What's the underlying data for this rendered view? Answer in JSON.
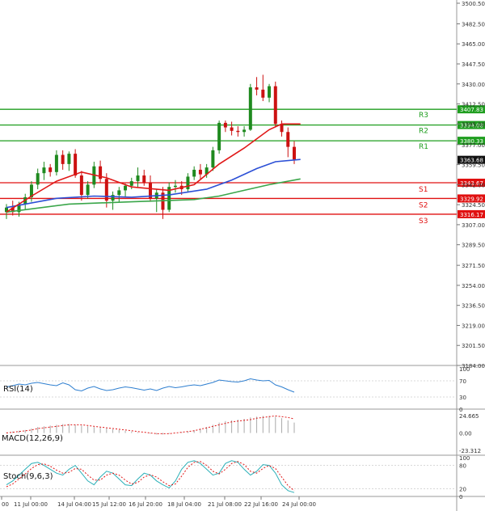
{
  "chart_data": {
    "type": "candlestick",
    "price_axis": {
      "min": 3184.0,
      "max": 3500.5,
      "ticks": [
        3500.5,
        3482.5,
        3465.0,
        3447.5,
        3430.0,
        3412.5,
        3395.0,
        3377.0,
        3359.5,
        3342.0,
        3324.5,
        3307.0,
        3289.5,
        3271.5,
        3254.0,
        3236.5,
        3219.0,
        3201.5,
        3184.0
      ]
    },
    "x_labels": [
      "00",
      "11 Jul 00:00",
      "14 Jul 04:00",
      "15 Jul 12:00",
      "16 Jul 20:00",
      "18 Jul 04:00",
      "21 Jul 08:00",
      "22 Jul 16:00",
      "24 Jul 00:00"
    ],
    "levels": [
      {
        "label": "R3",
        "value": 3407.83,
        "value_text": "3407.83",
        "color": "#1f9e1f"
      },
      {
        "label": "R2",
        "value": 3394.08,
        "value_text": "3394.08",
        "color": "#1f9e1f"
      },
      {
        "label": "R1",
        "value": 3380.33,
        "value_text": "3380.33",
        "color": "#1f9e1f"
      },
      {
        "label": "S1",
        "value": 3343.67,
        "value_text": "3343.67",
        "color": "#e01010"
      },
      {
        "label": "S2",
        "value": 3329.92,
        "value_text": "3329.92",
        "color": "#e01010"
      },
      {
        "label": "S3",
        "value": 3316.17,
        "value_text": "3316.17",
        "color": "#e01010"
      }
    ],
    "last_price": {
      "value": 3363.68,
      "text": "3363.68"
    },
    "candles": [
      {
        "o": 3318,
        "h": 3325,
        "l": 3312,
        "c": 3322
      },
      {
        "o": 3322,
        "h": 3328,
        "l": 3315,
        "c": 3318
      },
      {
        "o": 3318,
        "h": 3327,
        "l": 3314,
        "c": 3325
      },
      {
        "o": 3325,
        "h": 3334,
        "l": 3320,
        "c": 3331
      },
      {
        "o": 3331,
        "h": 3345,
        "l": 3327,
        "c": 3342
      },
      {
        "o": 3342,
        "h": 3356,
        "l": 3338,
        "c": 3352
      },
      {
        "o": 3352,
        "h": 3362,
        "l": 3346,
        "c": 3357
      },
      {
        "o": 3357,
        "h": 3360,
        "l": 3349,
        "c": 3353
      },
      {
        "o": 3353,
        "h": 3372,
        "l": 3350,
        "c": 3368
      },
      {
        "o": 3368,
        "h": 3372,
        "l": 3355,
        "c": 3360
      },
      {
        "o": 3360,
        "h": 3371,
        "l": 3354,
        "c": 3369
      },
      {
        "o": 3369,
        "h": 3373,
        "l": 3348,
        "c": 3350
      },
      {
        "o": 3350,
        "h": 3354,
        "l": 3328,
        "c": 3333
      },
      {
        "o": 3333,
        "h": 3345,
        "l": 3330,
        "c": 3342
      },
      {
        "o": 3342,
        "h": 3362,
        "l": 3339,
        "c": 3358
      },
      {
        "o": 3358,
        "h": 3363,
        "l": 3344,
        "c": 3347
      },
      {
        "o": 3347,
        "h": 3352,
        "l": 3322,
        "c": 3328
      },
      {
        "o": 3328,
        "h": 3336,
        "l": 3320,
        "c": 3333
      },
      {
        "o": 3333,
        "h": 3340,
        "l": 3327,
        "c": 3337
      },
      {
        "o": 3337,
        "h": 3343,
        "l": 3331,
        "c": 3341
      },
      {
        "o": 3341,
        "h": 3348,
        "l": 3338,
        "c": 3345
      },
      {
        "o": 3345,
        "h": 3357,
        "l": 3340,
        "c": 3350
      },
      {
        "o": 3350,
        "h": 3355,
        "l": 3341,
        "c": 3344
      },
      {
        "o": 3344,
        "h": 3350,
        "l": 3327,
        "c": 3330
      },
      {
        "o": 3330,
        "h": 3338,
        "l": 3318,
        "c": 3335
      },
      {
        "o": 3335,
        "h": 3340,
        "l": 3312,
        "c": 3320
      },
      {
        "o": 3320,
        "h": 3344,
        "l": 3318,
        "c": 3340
      },
      {
        "o": 3340,
        "h": 3346,
        "l": 3335,
        "c": 3341
      },
      {
        "o": 3341,
        "h": 3345,
        "l": 3333,
        "c": 3338
      },
      {
        "o": 3338,
        "h": 3352,
        "l": 3335,
        "c": 3349
      },
      {
        "o": 3349,
        "h": 3358,
        "l": 3346,
        "c": 3355
      },
      {
        "o": 3355,
        "h": 3360,
        "l": 3347,
        "c": 3351
      },
      {
        "o": 3351,
        "h": 3360,
        "l": 3348,
        "c": 3357
      },
      {
        "o": 3357,
        "h": 3375,
        "l": 3354,
        "c": 3372
      },
      {
        "o": 3372,
        "h": 3398,
        "l": 3369,
        "c": 3396
      },
      {
        "o": 3396,
        "h": 3398,
        "l": 3388,
        "c": 3392
      },
      {
        "o": 3392,
        "h": 3397,
        "l": 3385,
        "c": 3389
      },
      {
        "o": 3389,
        "h": 3393,
        "l": 3384,
        "c": 3388
      },
      {
        "o": 3388,
        "h": 3393,
        "l": 3384,
        "c": 3390
      },
      {
        "o": 3390,
        "h": 3430,
        "l": 3389,
        "c": 3427
      },
      {
        "o": 3427,
        "h": 3436,
        "l": 3420,
        "c": 3425
      },
      {
        "o": 3425,
        "h": 3438,
        "l": 3415,
        "c": 3418
      },
      {
        "o": 3418,
        "h": 3430,
        "l": 3414,
        "c": 3428
      },
      {
        "o": 3428,
        "h": 3432,
        "l": 3392,
        "c": 3395
      },
      {
        "o": 3395,
        "h": 3398,
        "l": 3384,
        "c": 3388
      },
      {
        "o": 3388,
        "h": 3392,
        "l": 3366,
        "c": 3375
      },
      {
        "o": 3375,
        "h": 3380,
        "l": 3360,
        "c": 3364
      }
    ],
    "ma_slow": [
      {
        "i": 0,
        "v": 3318
      },
      {
        "i": 10,
        "v": 3325
      },
      {
        "i": 20,
        "v": 3327
      },
      {
        "i": 30,
        "v": 3329
      },
      {
        "i": 34,
        "v": 3332
      },
      {
        "i": 38,
        "v": 3337
      },
      {
        "i": 42,
        "v": 3342
      },
      {
        "i": 47,
        "v": 3347
      }
    ],
    "ma_mid": [
      {
        "i": 0,
        "v": 3322
      },
      {
        "i": 8,
        "v": 3330
      },
      {
        "i": 14,
        "v": 3332
      },
      {
        "i": 20,
        "v": 3331
      },
      {
        "i": 26,
        "v": 3333
      },
      {
        "i": 32,
        "v": 3338
      },
      {
        "i": 36,
        "v": 3346
      },
      {
        "i": 40,
        "v": 3356
      },
      {
        "i": 43,
        "v": 3362
      },
      {
        "i": 47,
        "v": 3364
      }
    ],
    "ma_fast": [
      {
        "i": 0,
        "v": 3318
      },
      {
        "i": 4,
        "v": 3332
      },
      {
        "i": 8,
        "v": 3345
      },
      {
        "i": 12,
        "v": 3353
      },
      {
        "i": 16,
        "v": 3348
      },
      {
        "i": 20,
        "v": 3340
      },
      {
        "i": 26,
        "v": 3337
      },
      {
        "i": 30,
        "v": 3342
      },
      {
        "i": 34,
        "v": 3360
      },
      {
        "i": 38,
        "v": 3374
      },
      {
        "i": 42,
        "v": 3390
      },
      {
        "i": 44,
        "v": 3395
      },
      {
        "i": 47,
        "v": 3395
      }
    ],
    "rsi": {
      "label": "RSI(14)",
      "ticks": [
        "100",
        "70",
        "30",
        "0"
      ],
      "values": [
        55,
        58,
        62,
        60,
        64,
        66,
        63,
        60,
        58,
        65,
        60,
        48,
        45,
        52,
        56,
        50,
        46,
        48,
        52,
        55,
        53,
        50,
        47,
        50,
        46,
        52,
        56,
        53,
        55,
        58,
        60,
        58,
        62,
        66,
        72,
        70,
        68,
        67,
        70,
        75,
        72,
        70,
        71,
        60,
        55,
        48,
        42
      ]
    },
    "macd": {
      "label": "MACD(12,26,9)",
      "ticks": [
        "24.665",
        "0.00",
        "-23.312"
      ],
      "hist": [
        1,
        2,
        3,
        4,
        6,
        8,
        9,
        10,
        11,
        12,
        12,
        11,
        10,
        9,
        8,
        7,
        6,
        5,
        4,
        3,
        2,
        1,
        0,
        -1,
        -2,
        -2,
        -1,
        0,
        1,
        2,
        4,
        6,
        8,
        11,
        14,
        16,
        17,
        18,
        19,
        21,
        22,
        23,
        23,
        22,
        20,
        17,
        14
      ],
      "signal": [
        0,
        1,
        2,
        3,
        4,
        6,
        7,
        8,
        9,
        10,
        11,
        11,
        11,
        10,
        9,
        8,
        7,
        6,
        5,
        4,
        3,
        2,
        1,
        0,
        -1,
        -1,
        -1,
        0,
        1,
        2,
        3,
        5,
        7,
        9,
        11,
        13,
        15,
        16,
        17,
        18,
        20,
        21,
        22,
        23,
        22,
        21,
        19
      ]
    },
    "stoch": {
      "label": "Stoch(9,6,3)",
      "ticks": [
        "100",
        "80",
        "20",
        "0"
      ],
      "k": [
        30,
        40,
        55,
        70,
        85,
        88,
        80,
        70,
        60,
        55,
        70,
        80,
        60,
        40,
        30,
        50,
        65,
        60,
        45,
        30,
        28,
        45,
        60,
        55,
        40,
        30,
        22,
        40,
        70,
        88,
        92,
        85,
        70,
        55,
        60,
        85,
        92,
        88,
        70,
        55,
        65,
        82,
        80,
        60,
        30,
        15,
        10
      ],
      "d": [
        25,
        32,
        45,
        58,
        72,
        82,
        84,
        78,
        68,
        60,
        62,
        72,
        70,
        55,
        42,
        42,
        55,
        60,
        55,
        42,
        32,
        36,
        50,
        56,
        50,
        38,
        28,
        32,
        52,
        75,
        88,
        90,
        80,
        65,
        58,
        70,
        85,
        90,
        82,
        65,
        60,
        72,
        80,
        72,
        50,
        28,
        15
      ]
    }
  }
}
